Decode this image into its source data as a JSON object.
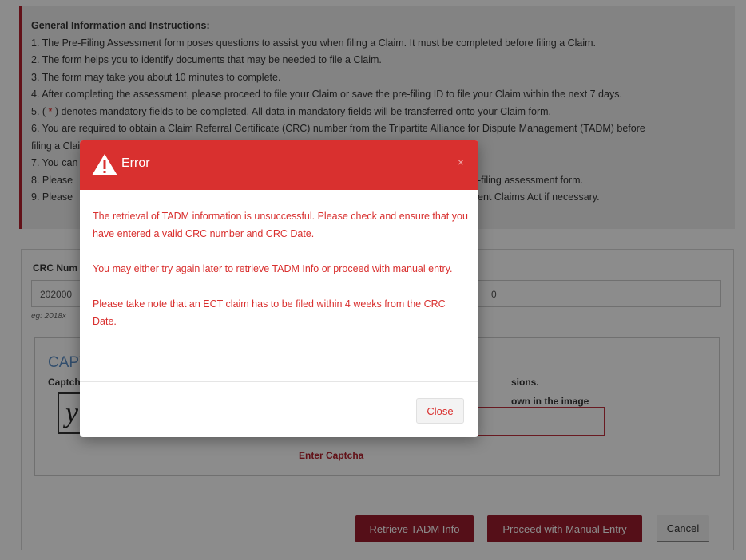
{
  "instructions": {
    "title": "General Information and Instructions:",
    "lines": [
      "1. The Pre-Filing Assessment form poses questions to assist you when filing a Claim. It must be completed before filing a Claim.",
      "2. The form helps you to identify documents that may be needed to file a Claim.",
      "3. The form may take you about 10 minutes to complete.",
      "4. After completing the assessment, please proceed to file your Claim or save the pre-filing ID to file your Claim within the next 7 days.",
      "5. ( * ) denotes mandatory fields to be completed. All data in mandatory fields will be transferred onto your Claim form.",
      "6. You are required to obtain a Claim Referral Certificate (CRC) number from the Tripartite Alliance for Dispute Management (TADM) before",
      "filing a Claim.",
      "7. You can",
      "8. Please",
      "9. Please"
    ],
    "line8_tail": "-filing assessment form.",
    "line9_tail": "ent Claims Act if necessary."
  },
  "form": {
    "crc_label": "CRC Num",
    "crc_value": "202000",
    "crc_date_value": "0",
    "hint": "eg: 2018x",
    "captcha": {
      "title": "CAPT",
      "label": "Captch",
      "image_text": "y",
      "instruction_1": "sions.",
      "instruction_2": "own in the image",
      "error": "Enter Captcha"
    },
    "buttons": {
      "retrieve": "Retrieve TADM Info",
      "manual": "Proceed with Manual Entry",
      "cancel": "Cancel"
    }
  },
  "modal": {
    "title": "Error",
    "close_x": "×",
    "paragraphs": [
      "The retrieval of TADM information is unsuccessful. Please check and ensure that you have entered a valid CRC number and CRC Date.",
      "You may either try again later to retrieve TADM Info or proceed with manual entry.",
      "Please take note that an ECT claim has to be filed within 4 weeks from the CRC Date."
    ],
    "close_button": "Close",
    "colors": {
      "header": "#d9302f",
      "text": "#d9302f"
    }
  },
  "colors": {
    "accent": "#9b1c2d",
    "info_border": "#b3202c",
    "captcha_title": "#5b8fc7"
  }
}
